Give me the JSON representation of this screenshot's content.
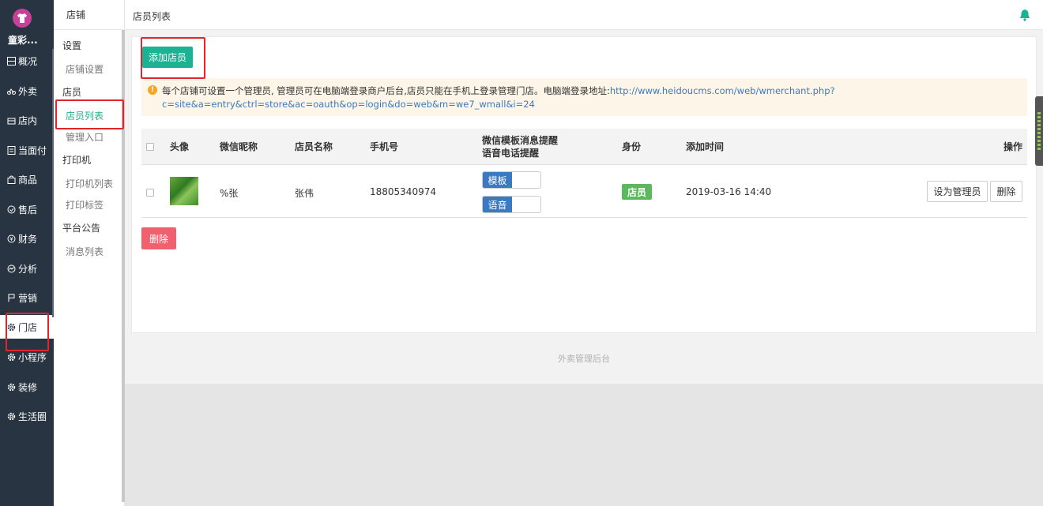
{
  "app": {
    "brand": "童彩...",
    "colors": {
      "sidebar": "#283442",
      "accent": "#1bb394",
      "link": "#3a7ac1",
      "danger": "#f1616d",
      "badge": "#5cb85c"
    }
  },
  "sidebar": {
    "items": [
      {
        "label": "概况",
        "icon": "dashboard-icon"
      },
      {
        "label": "外卖",
        "icon": "bike-icon"
      },
      {
        "label": "店内",
        "icon": "store-icon"
      },
      {
        "label": "当面付",
        "icon": "document-icon"
      },
      {
        "label": "商品",
        "icon": "bag-icon"
      },
      {
        "label": "售后",
        "icon": "service-icon"
      },
      {
        "label": "财务",
        "icon": "money-icon"
      },
      {
        "label": "分析",
        "icon": "chart-icon"
      },
      {
        "label": "营销",
        "icon": "flag-icon"
      },
      {
        "label": "门店",
        "icon": "gear-icon",
        "active": true
      },
      {
        "label": "小程序",
        "icon": "gear-icon"
      },
      {
        "label": "装修",
        "icon": "gear-icon"
      },
      {
        "label": "生活圈",
        "icon": "gear-icon"
      }
    ]
  },
  "submenu": {
    "title": "店铺",
    "groups": [
      {
        "label": "设置",
        "items": [
          "店铺设置"
        ]
      },
      {
        "label": "店员",
        "items": [
          "店员列表",
          "管理入口"
        ]
      },
      {
        "label": "打印机",
        "items": [
          "打印机列表",
          "打印标签"
        ]
      },
      {
        "label": "平台公告",
        "items": [
          "消息列表"
        ]
      }
    ],
    "active_item": "店员列表"
  },
  "header": {
    "title": "店员列表",
    "icon": "bell-icon"
  },
  "main": {
    "add_button": "添加店员",
    "notice_text": "每个店铺可设置一个管理员, 管理员可在电脑端登录商户后台,店员只能在手机上登录管理门店。电脑端登录地址:",
    "notice_link_1": "http://www.heidoucms.com/web/wmerchant.php?",
    "notice_link_2": "c=site&a=entry&ctrl=store&ac=oauth&op=login&do=web&m=we7_wmall&i=24",
    "columns": {
      "avatar": "头像",
      "nickname": "微信昵称",
      "name": "店员名称",
      "phone": "手机号",
      "notify_1": "微信模板消息提醒",
      "notify_2": "语音电话提醒",
      "role": "身份",
      "added": "添加时间",
      "ops": "操作"
    },
    "rows": [
      {
        "nickname": "%张",
        "name": "张伟",
        "phone": "18805340974",
        "template_toggle": "模板",
        "voice_toggle": "语音",
        "role": "店员",
        "added": "2019-03-16 14:40",
        "set_admin": "设为管理员",
        "delete": "删除"
      }
    ],
    "bulk_delete": "删除"
  },
  "footer": {
    "text": "外卖管理后台"
  }
}
